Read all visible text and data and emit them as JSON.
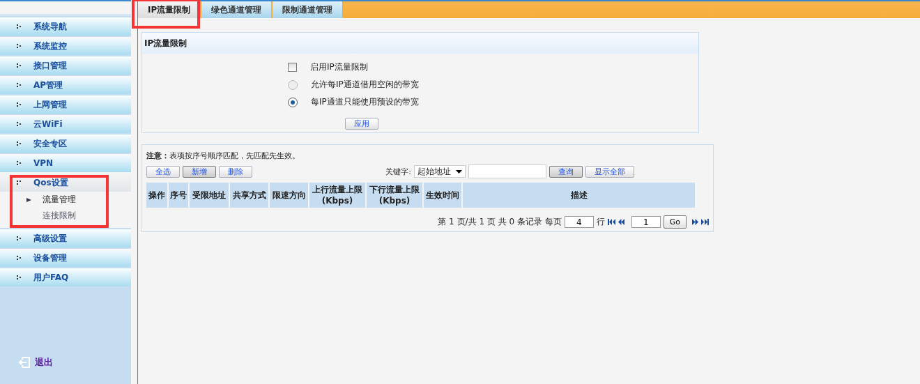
{
  "sidebar": {
    "items": [
      {
        "label": "系统导航",
        "expanded": false
      },
      {
        "label": "系统监控",
        "expanded": false
      },
      {
        "label": "接口管理",
        "expanded": false
      },
      {
        "label": "AP管理",
        "expanded": false
      },
      {
        "label": "上网管理",
        "expanded": false
      },
      {
        "label": "云WiFi",
        "expanded": false
      },
      {
        "label": "安全专区",
        "expanded": false
      },
      {
        "label": "VPN",
        "expanded": false
      },
      {
        "label": "Qos设置",
        "expanded": true,
        "highlighted": true,
        "children": [
          {
            "label": "流量管理",
            "selected": true
          },
          {
            "label": "连接限制",
            "selected": false
          }
        ]
      },
      {
        "label": "高级设置",
        "expanded": false
      },
      {
        "label": "设备管理",
        "expanded": false
      },
      {
        "label": "用户FAQ",
        "expanded": false
      }
    ],
    "logout": "退出"
  },
  "tabs": [
    {
      "label": "IP流量限制",
      "selected": true,
      "highlighted": true
    },
    {
      "label": "绿色通道管理",
      "selected": false,
      "highlighted": false
    },
    {
      "label": "限制通道管理",
      "selected": false,
      "highlighted": false
    }
  ],
  "settings": {
    "title": "IP流量限制",
    "options": [
      {
        "kind": "checkbox",
        "label": "启用IP流量限制",
        "checked": false
      },
      {
        "kind": "radio",
        "label": "允许每IP通道借用空闲的带宽",
        "checked": false
      },
      {
        "kind": "radio",
        "label": "每IP通道只能使用预设的带宽",
        "checked": true
      }
    ],
    "apply_button": "应用"
  },
  "list": {
    "note_label": "注意：",
    "note": "表项按序号顺序匹配，先匹配先生效。",
    "buttons": [
      "全选",
      "新增",
      "删除"
    ],
    "keyword_label": "关键字:",
    "keyword_select": "起始地址",
    "search_button": "查询",
    "show_all_button": "显示全部",
    "columns": [
      "操作",
      "序号",
      "受限地址",
      "共享方式",
      "限速方向",
      "上行流量上限\n(Kbps)",
      "下行流量上限\n(Kbps)",
      "生效时间",
      "描述"
    ],
    "pager": {
      "summary": "第 1 页/共 1 页 共 0 条记录 每页",
      "per_page": "4",
      "rows_label": "行",
      "page": "1",
      "go": "Go"
    }
  }
}
